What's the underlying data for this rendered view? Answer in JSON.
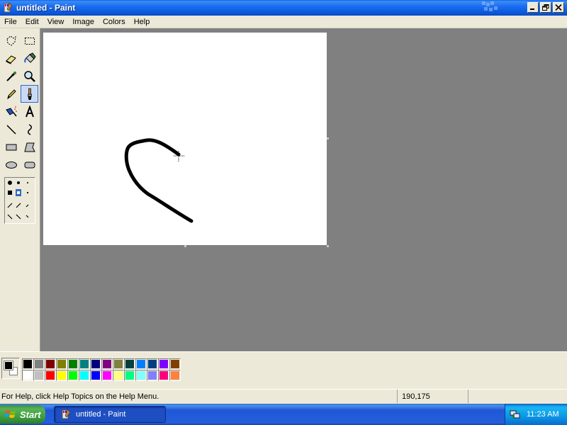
{
  "window": {
    "title": "untitled - Paint"
  },
  "menu": [
    "File",
    "Edit",
    "View",
    "Image",
    "Colors",
    "Help"
  ],
  "tools": [
    {
      "name": "free-select-icon"
    },
    {
      "name": "rect-select-icon"
    },
    {
      "name": "eraser-icon"
    },
    {
      "name": "fill-bucket-icon"
    },
    {
      "name": "color-picker-icon"
    },
    {
      "name": "magnifier-icon"
    },
    {
      "name": "pencil-icon"
    },
    {
      "name": "brush-icon",
      "selected": true
    },
    {
      "name": "airbrush-icon"
    },
    {
      "name": "text-icon"
    },
    {
      "name": "line-icon"
    },
    {
      "name": "curve-icon"
    },
    {
      "name": "rectangle-icon"
    },
    {
      "name": "polygon-icon"
    },
    {
      "name": "ellipse-icon"
    },
    {
      "name": "rounded-rect-icon"
    }
  ],
  "colors": {
    "foreground": "#000000",
    "background": "#ffffff",
    "palette_top": [
      "#000000",
      "#808080",
      "#800000",
      "#808000",
      "#008000",
      "#008080",
      "#000080",
      "#800080",
      "#808040",
      "#004040",
      "#0080ff",
      "#004080",
      "#8000ff",
      "#804000"
    ],
    "palette_bottom": [
      "#ffffff",
      "#c0c0c0",
      "#ff0000",
      "#ffff00",
      "#00ff00",
      "#00ffff",
      "#0000ff",
      "#ff00ff",
      "#ffff80",
      "#00ff80",
      "#80ffff",
      "#8080ff",
      "#ff0080",
      "#ff8040"
    ]
  },
  "status": {
    "help_text": "For Help, click Help Topics on the Help Menu.",
    "coords": "190,175"
  },
  "taskbar": {
    "start_label": "Start",
    "task_label": "untitled - Paint",
    "clock": "11:23 AM"
  }
}
